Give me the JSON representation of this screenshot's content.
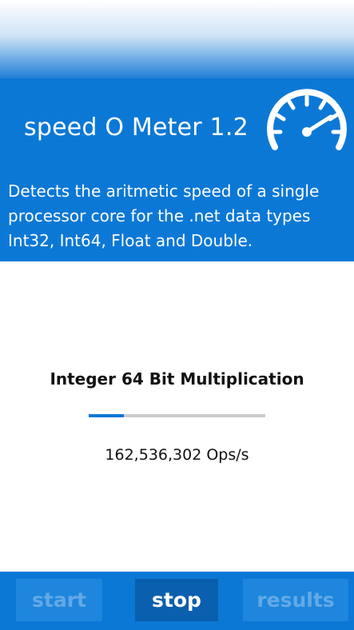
{
  "app": {
    "title": "speed O Meter 1.2",
    "description": "Detects the aritmetic speed of a single processor core for the .net data types Int32, Int64, Float and Double."
  },
  "icons": {
    "header_icon": "speedometer-icon"
  },
  "test": {
    "name": "Integer 64 Bit Multiplication",
    "progress_fraction": 0.2,
    "result": "162,536,302 Ops/s"
  },
  "buttons": {
    "start_label": "start",
    "start_enabled": false,
    "stop_label": "stop",
    "stop_enabled": true,
    "results_label": "results",
    "results_enabled": false
  },
  "colors": {
    "accent": "#0c78d6",
    "active_button": "#0a5fae",
    "disabled_text": "#63a9e6",
    "progress_track": "#cccccc"
  }
}
